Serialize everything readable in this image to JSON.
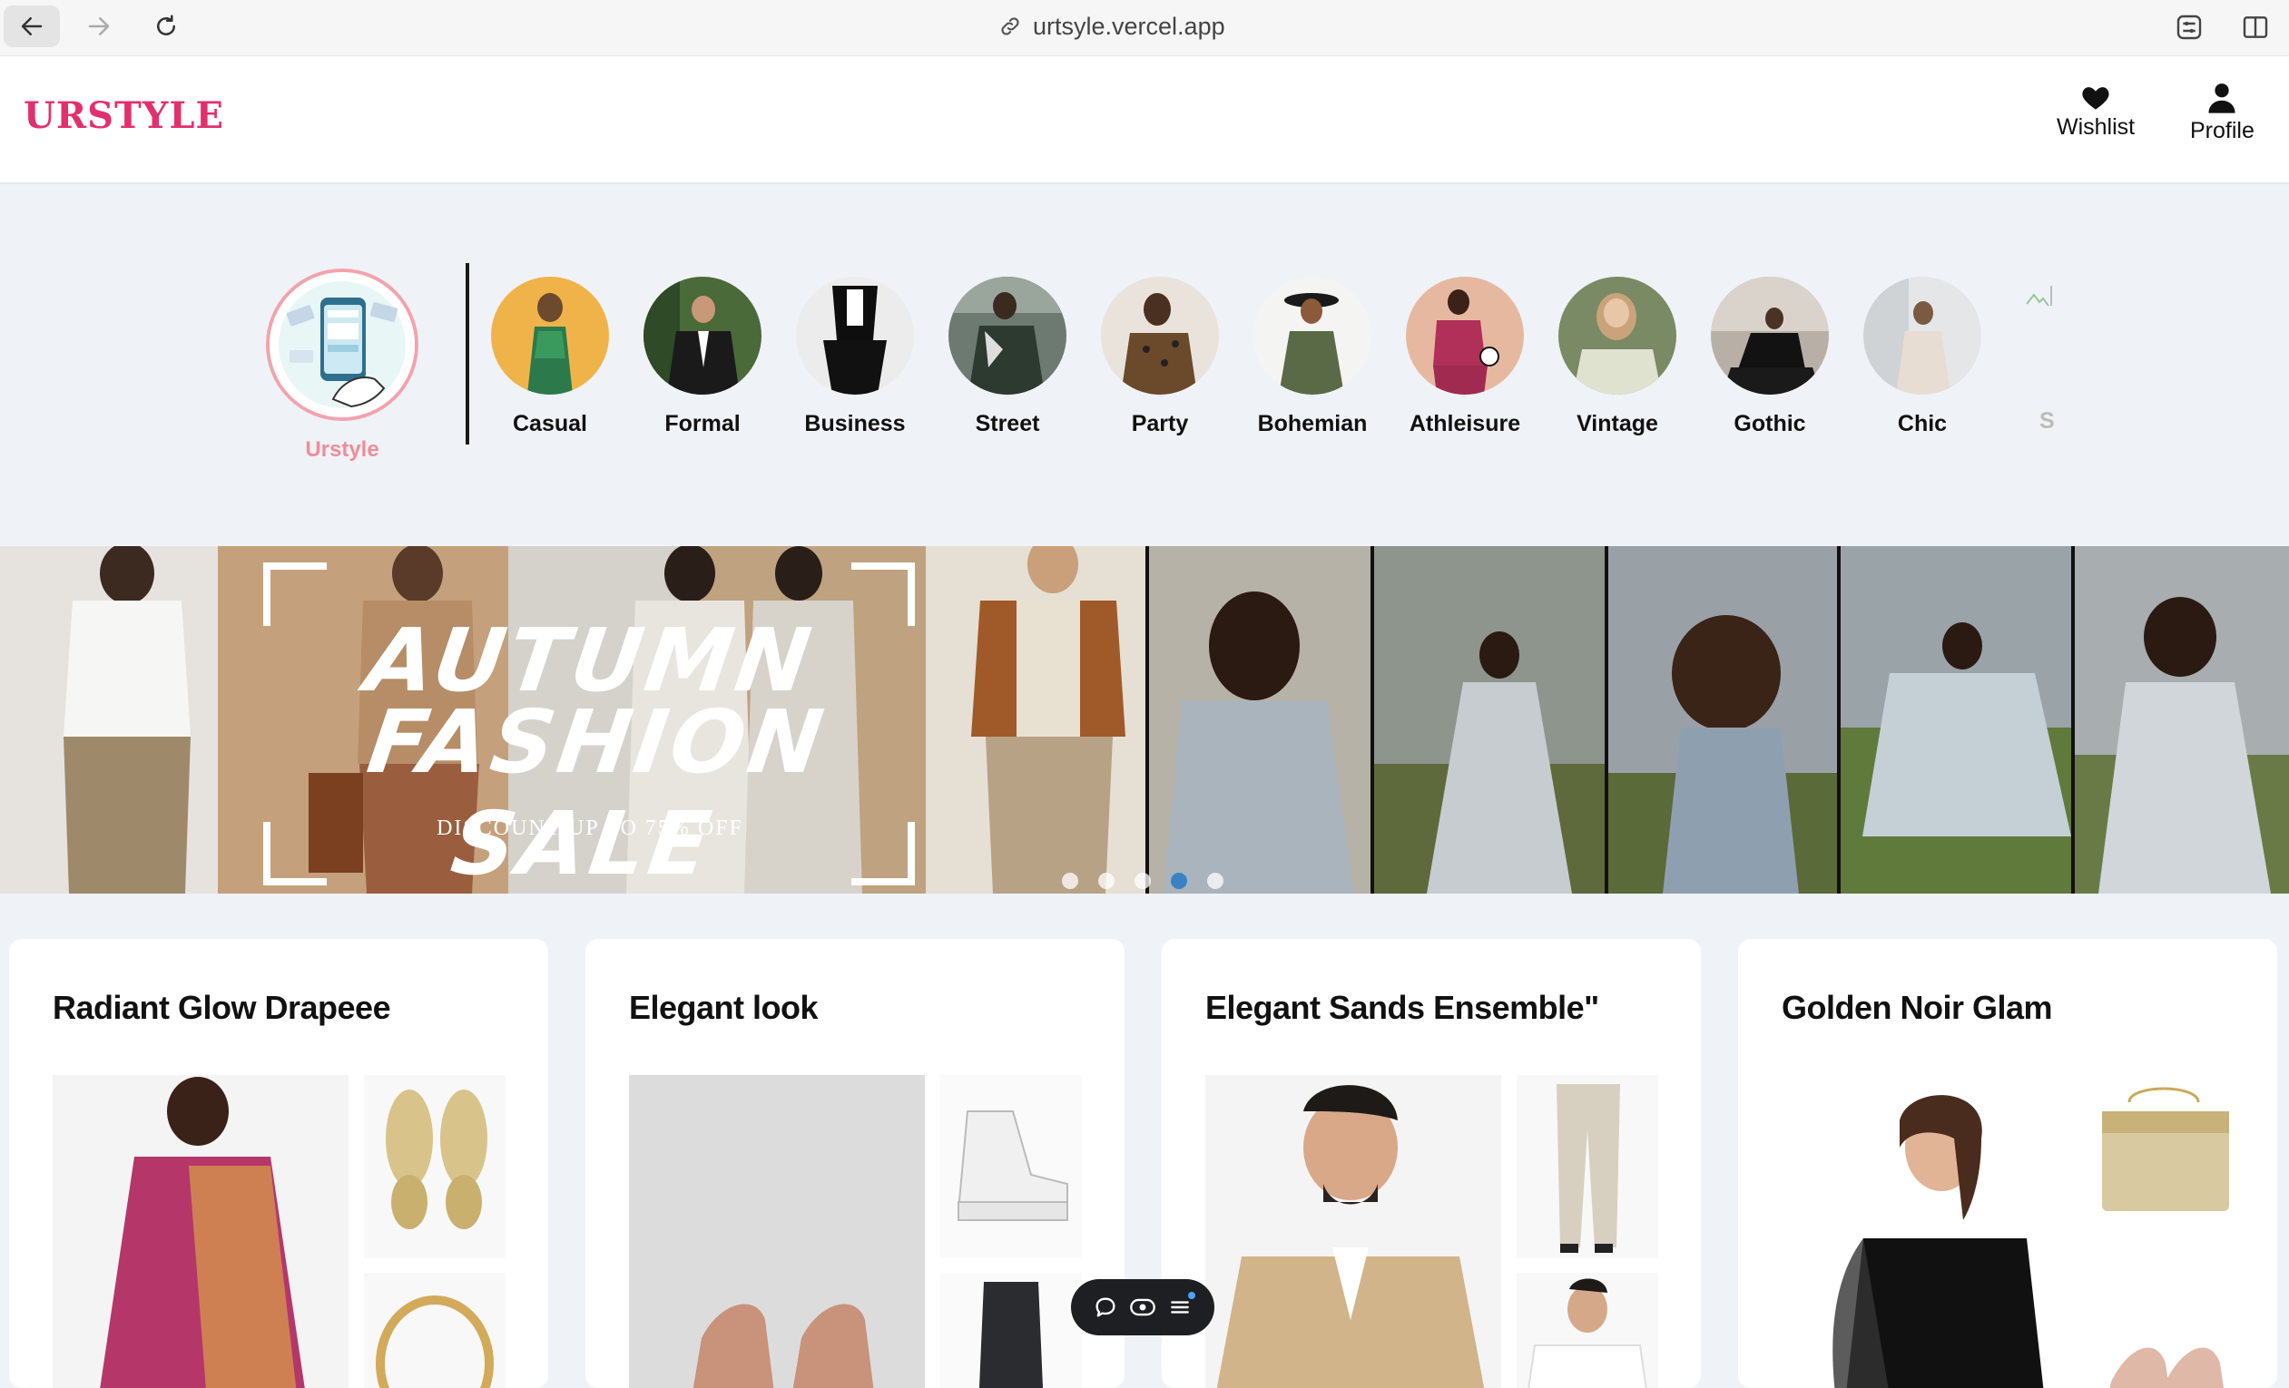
{
  "browser": {
    "url": "urtsyle.vercel.app",
    "icons": [
      "back-arrow-icon",
      "forward-arrow-icon",
      "reload-icon",
      "link-icon",
      "extensions-icon",
      "sidebar-icon"
    ]
  },
  "header": {
    "logo": "URSTYLE",
    "wishlist_label": "Wishlist",
    "profile_label": "Profile",
    "accent": "#e2306c"
  },
  "categories": {
    "brand_label": "Urstyle",
    "brand_accent": "#f08d97",
    "items": [
      {
        "label": "Casual"
      },
      {
        "label": "Formal"
      },
      {
        "label": "Business"
      },
      {
        "label": "Street"
      },
      {
        "label": "Party"
      },
      {
        "label": "Bohemian"
      },
      {
        "label": "Athleisure"
      },
      {
        "label": "Vintage"
      },
      {
        "label": "Gothic"
      },
      {
        "label": "Chic"
      }
    ],
    "partial_label": "Sp"
  },
  "banner": {
    "line1": "AUTUMN",
    "line2": "FASHION SALE",
    "subtitle": "DISCOUNT UP TO 75% OFF",
    "slide_count": 5,
    "active_slide": 4
  },
  "cards": [
    {
      "title": "Radiant Glow Drapeee"
    },
    {
      "title": "Elegant look"
    },
    {
      "title": "Elegant Sands Ensemble\""
    },
    {
      "title": "Golden Noir Glam"
    }
  ]
}
